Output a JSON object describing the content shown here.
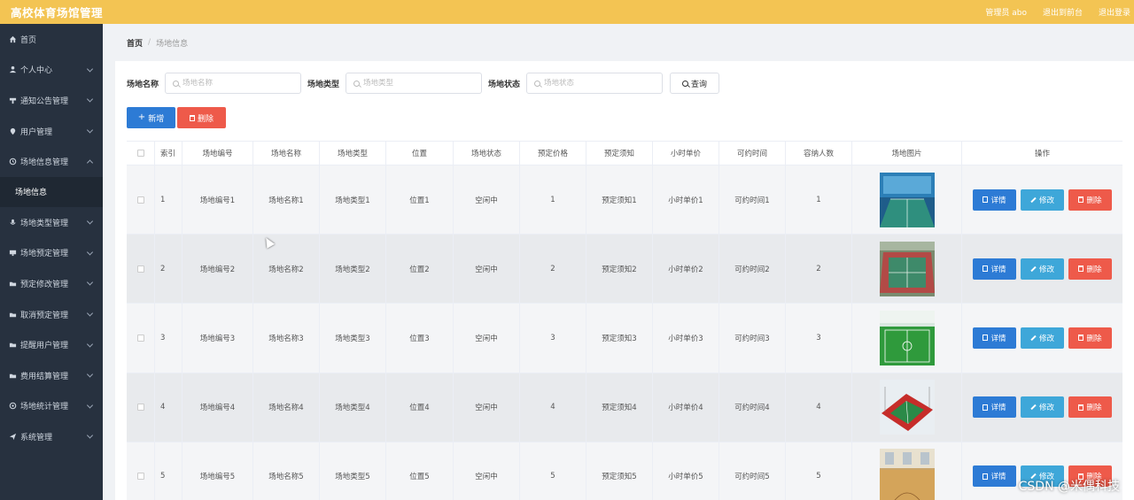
{
  "app": {
    "title": "高校体育场馆管理",
    "top_links": [
      "管理员 abo",
      "退出到前台",
      "退出登录"
    ]
  },
  "sidebar": {
    "items": [
      {
        "label": "首页",
        "icon": "home-icon",
        "has_children": false
      },
      {
        "label": "个人中心",
        "icon": "user-icon",
        "has_children": true
      },
      {
        "label": "通知公告管理",
        "icon": "notice-icon",
        "has_children": true
      },
      {
        "label": "用户管理",
        "icon": "location-icon",
        "has_children": true
      },
      {
        "label": "场地信息管理",
        "icon": "clock-icon",
        "has_children": true,
        "expanded": true
      },
      {
        "label": "场地类型管理",
        "icon": "mic-icon",
        "has_children": true
      },
      {
        "label": "场地预定管理",
        "icon": "monitor-icon",
        "has_children": true
      },
      {
        "label": "预定修改管理",
        "icon": "folder-icon",
        "has_children": true
      },
      {
        "label": "取消预定管理",
        "icon": "folder-icon",
        "has_children": true
      },
      {
        "label": "提醒用户管理",
        "icon": "folder-icon",
        "has_children": true
      },
      {
        "label": "费用结算管理",
        "icon": "folder-icon",
        "has_children": true
      },
      {
        "label": "场地统计管理",
        "icon": "settings-icon",
        "has_children": true
      },
      {
        "label": "系统管理",
        "icon": "send-icon",
        "has_children": true
      }
    ],
    "sub_item": "场地信息"
  },
  "breadcrumb": {
    "home": "首页",
    "separator": "/",
    "current": "场地信息"
  },
  "search": {
    "fields": [
      {
        "label": "场地名称",
        "placeholder": "场地名称"
      },
      {
        "label": "场地类型",
        "placeholder": "场地类型"
      },
      {
        "label": "场地状态",
        "placeholder": "场地状态"
      }
    ],
    "query_label": "查询"
  },
  "actions": {
    "add_label": "新增",
    "delete_label": "删除"
  },
  "table": {
    "headers": [
      "索引",
      "场地编号",
      "场地名称",
      "场地类型",
      "位置",
      "场地状态",
      "预定价格",
      "预定须知",
      "小时单价",
      "可约时间",
      "容纳人数",
      "场地图片",
      "操作"
    ],
    "rows": [
      {
        "index": "1",
        "no": "场地编号1",
        "name": "场地名称1",
        "type": "场地类型1",
        "pos": "位置1",
        "status": "空闲中",
        "price": "1",
        "note": "预定须知1",
        "unit": "小时单价1",
        "time": "可约时间1",
        "cap": "1"
      },
      {
        "index": "2",
        "no": "场地编号2",
        "name": "场地名称2",
        "type": "场地类型2",
        "pos": "位置2",
        "status": "空闲中",
        "price": "2",
        "note": "预定须知2",
        "unit": "小时单价2",
        "time": "可约时间2",
        "cap": "2"
      },
      {
        "index": "3",
        "no": "场地编号3",
        "name": "场地名称3",
        "type": "场地类型3",
        "pos": "位置3",
        "status": "空闲中",
        "price": "3",
        "note": "预定须知3",
        "unit": "小时单价3",
        "time": "可约时间3",
        "cap": "3"
      },
      {
        "index": "4",
        "no": "场地编号4",
        "name": "场地名称4",
        "type": "场地类型4",
        "pos": "位置4",
        "status": "空闲中",
        "price": "4",
        "note": "预定须知4",
        "unit": "小时单价4",
        "time": "可约时间4",
        "cap": "4"
      },
      {
        "index": "5",
        "no": "场地编号5",
        "name": "场地名称5",
        "type": "场地类型5",
        "pos": "位置5",
        "status": "空闲中",
        "price": "5",
        "note": "预定须知5",
        "unit": "小时单价5",
        "time": "可约时间5",
        "cap": "5"
      }
    ],
    "op_labels": {
      "detail": "详情",
      "edit": "修改",
      "delete": "删除"
    }
  },
  "watermark": "CSDN @米偶科技",
  "colors": {
    "topbar": "#f3c453",
    "sidebar": "#27313f",
    "primary": "#2d7bd5",
    "info": "#3ea7d9",
    "danger": "#ee5a4a"
  }
}
